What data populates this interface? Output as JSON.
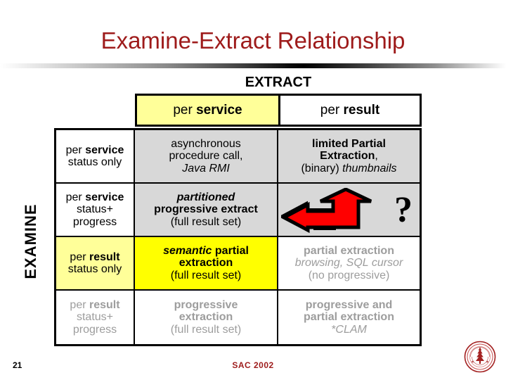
{
  "slide": {
    "title": "Examine-Extract Relationship",
    "title_color": "#9e1b1b",
    "axis_top_label": "EXTRACT",
    "axis_left_label": "EXAMINE"
  },
  "colors": {
    "title_red": "#9e1b1b",
    "highlight_yellow": "#ffff00",
    "light_yellow": "#ffff99",
    "cell_gray": "#d8d8d8",
    "muted_text": "#9d9d9d",
    "arrow_red": "#ff0000",
    "arrow_outline": "#000000"
  },
  "column_headers": [
    {
      "prefix": "per ",
      "strong": "service",
      "background": "#ffff99"
    },
    {
      "prefix": "per ",
      "strong": "result",
      "background": "#ffffff"
    }
  ],
  "rows": [
    {
      "header": {
        "line1_prefix": "per ",
        "line1_strong": "service",
        "line2": "status only",
        "background": "#ffffff",
        "muted": false
      },
      "cells": [
        {
          "background": "#d8d8d8",
          "muted": false,
          "lines": [
            {
              "text": "asynchronous",
              "style": "normal"
            },
            {
              "text": "procedure call,",
              "style": "normal"
            },
            {
              "text": "Java RMI",
              "style": "italic"
            }
          ]
        },
        {
          "background": "#d8d8d8",
          "muted": false,
          "lines": [
            {
              "text": "limited Partial",
              "style": "bold"
            },
            {
              "text": "Extraction,",
              "style": "bold-comma"
            },
            {
              "text": "(binary) thumbnails",
              "style": "mixed-paren-italic"
            }
          ]
        }
      ]
    },
    {
      "header": {
        "line1_prefix": "per ",
        "line1_strong": "service",
        "line2": "status+",
        "line3": "progress",
        "background": "#ffffff",
        "muted": false
      },
      "cells": [
        {
          "background": "#d8d8d8",
          "muted": false,
          "lines": [
            {
              "text": "partitioned",
              "style": "bold-italic"
            },
            {
              "text": "progressive extract",
              "style": "bold"
            },
            {
              "text": "(full result set)",
              "style": "normal"
            }
          ]
        },
        {
          "background": "#d8d8d8",
          "muted": false,
          "graphic": "bent-arrow-left-up",
          "question_mark": "?"
        }
      ]
    },
    {
      "header": {
        "line1_prefix": "per ",
        "line1_strong": "result",
        "line2": "status only",
        "background": "#ffff99",
        "muted": false
      },
      "cells": [
        {
          "background": "#ffff00",
          "muted": false,
          "lines": [
            {
              "text": "semantic partial",
              "style": "bolditalic-plus-bold"
            },
            {
              "text": "extraction",
              "style": "bold"
            },
            {
              "text": "(full result set)",
              "style": "normal"
            }
          ]
        },
        {
          "background": "#ffffff",
          "muted": true,
          "lines": [
            {
              "text": "partial extraction",
              "style": "bold"
            },
            {
              "text": "browsing, SQL cursor",
              "style": "italic"
            },
            {
              "text": "(no progressive)",
              "style": "normal"
            }
          ]
        }
      ]
    },
    {
      "header": {
        "line1_prefix": "per ",
        "line1_strong": "result",
        "line2": "status+",
        "line3": "progress",
        "background": "#ffffff",
        "muted": true
      },
      "cells": [
        {
          "background": "#ffffff",
          "muted": true,
          "lines": [
            {
              "text": "progressive",
              "style": "bold"
            },
            {
              "text": "extraction",
              "style": "bold"
            },
            {
              "text": "(full result set)",
              "style": "normal"
            }
          ]
        },
        {
          "background": "#ffffff",
          "muted": true,
          "lines": [
            {
              "text": "progressive and",
              "style": "bold"
            },
            {
              "text": "partial extraction",
              "style": "bold"
            },
            {
              "text": "*CLAM",
              "style": "italic"
            }
          ]
        }
      ]
    }
  ],
  "cell_texts": {
    "r1c1_l1": "asynchronous",
    "r1c1_l2": "procedure call,",
    "r1c1_l3": "Java RMI",
    "r1c2_l1": "limited Partial",
    "r1c2_l2a": "Extraction",
    "r1c2_l2b": ",",
    "r1c2_l3a": "(binary) ",
    "r1c2_l3b": "thumbnails",
    "r2c1_l1": "partitioned",
    "r2c1_l2": "progressive extract",
    "r2c1_l3": "(full result set)",
    "r2c2_q": "?",
    "r3c1_l1a": "semantic",
    "r3c1_l1b": " partial",
    "r3c1_l2": "extraction",
    "r3c1_l3": "(full result set)",
    "r3c2_l1": "partial extraction",
    "r3c2_l2": "browsing, SQL cursor",
    "r3c2_l3": "(no progressive)",
    "r4c1_l1": "progressive",
    "r4c1_l2": "extraction",
    "r4c1_l3": "(full result set)",
    "r4c2_l1": "progressive and",
    "r4c2_l2": "partial extraction",
    "r4c2_l3": "*CLAM"
  },
  "row_headers": {
    "r1_prefix": "per ",
    "r1_strong": "service",
    "r1_line2": "status only",
    "r2_prefix": "per ",
    "r2_strong": "service",
    "r2_line2": "status+",
    "r2_line3": "progress",
    "r3_prefix": "per ",
    "r3_strong": "result",
    "r3_line2": "status only",
    "r4_prefix": "per ",
    "r4_strong": "result",
    "r4_line2": "status+",
    "r4_line3": "progress"
  },
  "footer": {
    "page_number": "21",
    "conference": "SAC 2002",
    "logo": "stanford-seal-icon"
  }
}
